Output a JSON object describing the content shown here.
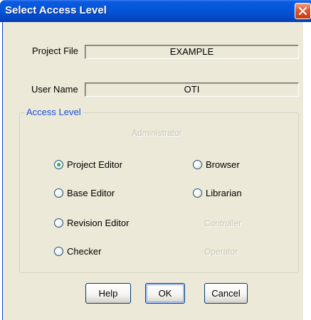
{
  "window": {
    "title": "Select Access Level"
  },
  "fields": {
    "project_file_label": "Project File",
    "project_file_value": "EXAMPLE",
    "user_name_label": "User Name",
    "user_name_value": "OTI"
  },
  "access_level": {
    "group_title": "Access Level",
    "administrator": "Administrator",
    "options": [
      {
        "label": "Project Editor",
        "selected": true,
        "enabled": true
      },
      {
        "label": "Browser",
        "selected": false,
        "enabled": true
      },
      {
        "label": "Base Editor",
        "selected": false,
        "enabled": true
      },
      {
        "label": "Librarian",
        "selected": false,
        "enabled": true
      },
      {
        "label": "Revision Editor",
        "selected": false,
        "enabled": true
      },
      {
        "label": "Controller",
        "selected": false,
        "enabled": false
      },
      {
        "label": "Checker",
        "selected": false,
        "enabled": true
      },
      {
        "label": "Operator",
        "selected": false,
        "enabled": false
      }
    ]
  },
  "buttons": {
    "help": "Help",
    "ok": "OK",
    "cancel": "Cancel"
  },
  "colors": {
    "titlebar": "#0555d8",
    "dialog_background": "#ece9d8",
    "group_title": "#1a4fd6",
    "selected_radio": "#21a121"
  },
  "icons": {
    "close": "close-x-icon"
  }
}
